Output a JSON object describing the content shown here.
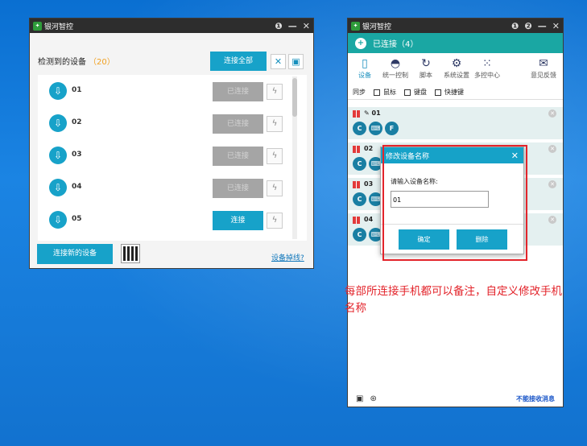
{
  "left_window": {
    "title": "银河智控",
    "controls": [
      "❶",
      "—",
      "✕"
    ],
    "detected_label": "检测到的设备",
    "detected_count": "（20）",
    "connect_all": "连接全部",
    "devices": [
      {
        "name": "01",
        "action": "已连接",
        "state": "disabled"
      },
      {
        "name": "02",
        "action": "已连接",
        "state": "disabled"
      },
      {
        "name": "03",
        "action": "已连接",
        "state": "disabled"
      },
      {
        "name": "04",
        "action": "已连接",
        "state": "disabled"
      },
      {
        "name": "05",
        "action": "连接",
        "state": "active"
      }
    ],
    "connect_new": "连接新的设备",
    "disconnect_link": "设备掉线?"
  },
  "right_window": {
    "title": "银河智控",
    "controls": [
      "❶",
      "❷",
      "—",
      "✕"
    ],
    "connected_label": "已连接（4）",
    "tools": [
      {
        "label": "设备",
        "icon": "phone-icon"
      },
      {
        "label": "统一控制",
        "icon": "control-icon"
      },
      {
        "label": "脚本",
        "icon": "script-icon"
      },
      {
        "label": "系统设置",
        "icon": "gear-icon"
      },
      {
        "label": "多控中心",
        "icon": "grid-icon"
      },
      {
        "label": "意见反馈",
        "icon": "feedback-icon"
      }
    ],
    "sync_label": "同步",
    "sync_options": [
      "鼠标",
      "键盘",
      "快捷键"
    ],
    "devices": [
      {
        "name": "01"
      },
      {
        "name": "02"
      },
      {
        "name": "03"
      },
      {
        "name": "04"
      }
    ],
    "bottom_message": "不能接收消息"
  },
  "dialog": {
    "title": "修改设备名称",
    "prompt": "请输入设备名称:",
    "input_value": "01",
    "confirm": "确定",
    "delete": "删除"
  },
  "annotation": "每部所连接手机都可以备注，自定义修改手机名称",
  "colors": {
    "accent": "#17a2c9",
    "teal": "#1aa7a3",
    "annotation": "#e3242b"
  }
}
